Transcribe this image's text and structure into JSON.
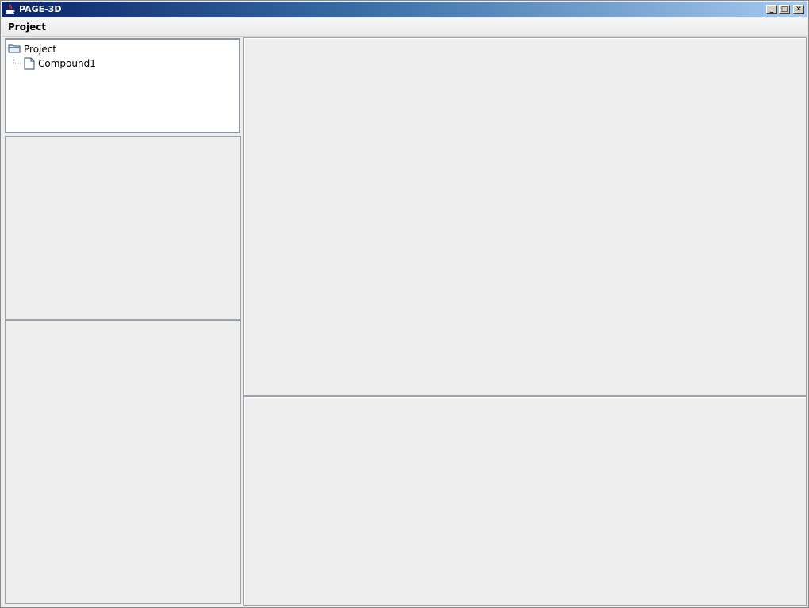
{
  "window": {
    "title": "PAGE-3D",
    "app_icon": "java-cup-icon",
    "controls": [
      "minimize-icon",
      "maximize-icon",
      "close-icon"
    ]
  },
  "menubar": {
    "items": [
      {
        "label": "Project"
      }
    ]
  },
  "tree": {
    "root": {
      "label": "Project",
      "icon": "folder-icon"
    },
    "children": [
      {
        "label": "Compound1",
        "icon": "file-icon"
      }
    ]
  }
}
